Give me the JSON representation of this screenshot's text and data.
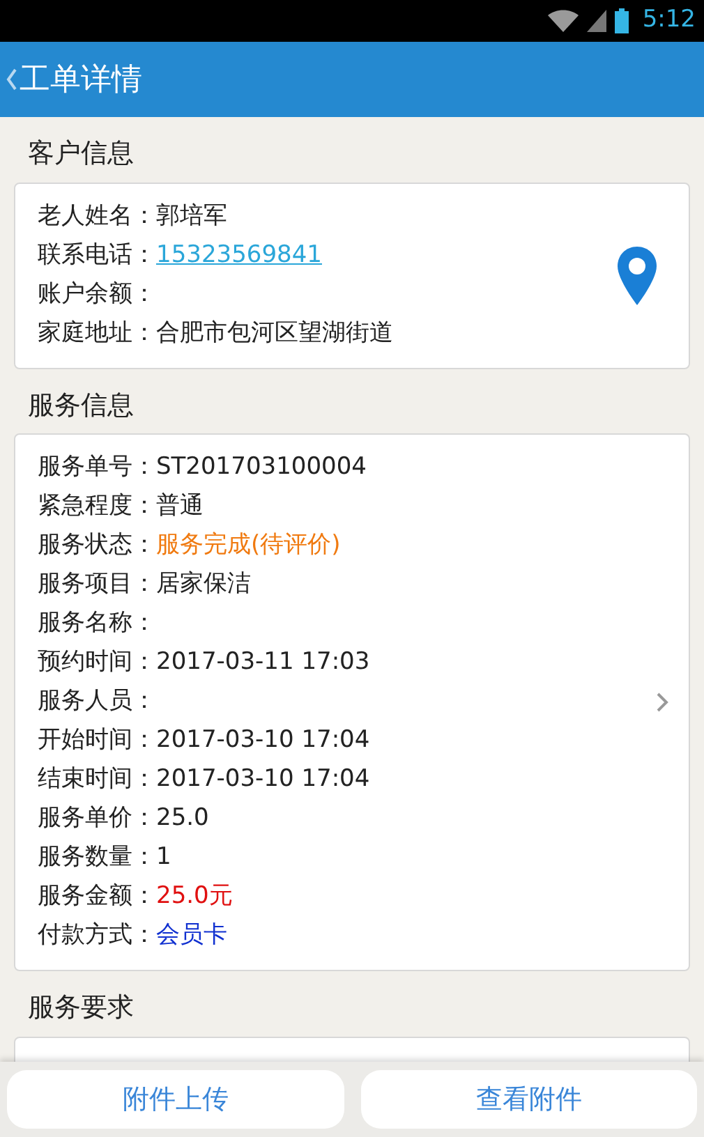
{
  "status_bar": {
    "time": "5:12"
  },
  "header": {
    "title": "工单详情"
  },
  "sections": [
    {
      "title": "客户信息",
      "kind": "location",
      "rows": [
        {
          "label": "老人姓名：",
          "value": "郭培军"
        },
        {
          "label": "联系电话：",
          "value": "15323569841",
          "link": true,
          "color": "#2aa6d9"
        },
        {
          "label": "账户余额："
        },
        {
          "label": "家庭地址：",
          "value": "合肥市包河区望湖街道"
        }
      ]
    },
    {
      "title": "服务信息",
      "kind": "more",
      "rows": [
        {
          "label": "服务单号：",
          "value": "ST201703100004"
        },
        {
          "label": "紧急程度：",
          "value": "普通"
        },
        {
          "label": "服务状态：",
          "value": "服务完成(待评价)",
          "color": "#f07a10"
        },
        {
          "label": "服务项目：",
          "value": "居家保洁"
        },
        {
          "label": "服务名称："
        },
        {
          "label": "预约时间：",
          "value": "2017-03-11 17:03"
        },
        {
          "label": "服务人员："
        },
        {
          "label": "开始时间：",
          "value": "2017-03-10 17:04"
        },
        {
          "label": "结束时间：",
          "value": "2017-03-10 17:04"
        },
        {
          "label": "服务单价：",
          "value": "25.0"
        },
        {
          "label": "服务数量：",
          "value": "1"
        },
        {
          "label": "服务金额：",
          "value": "25.0元",
          "color": "#e01010"
        },
        {
          "label": "付款方式：",
          "value": "会员卡",
          "color": "#1030d0"
        }
      ]
    },
    {
      "title": "服务要求",
      "kind": "text"
    }
  ],
  "buttons": [
    "附件上传",
    "查看附件"
  ]
}
